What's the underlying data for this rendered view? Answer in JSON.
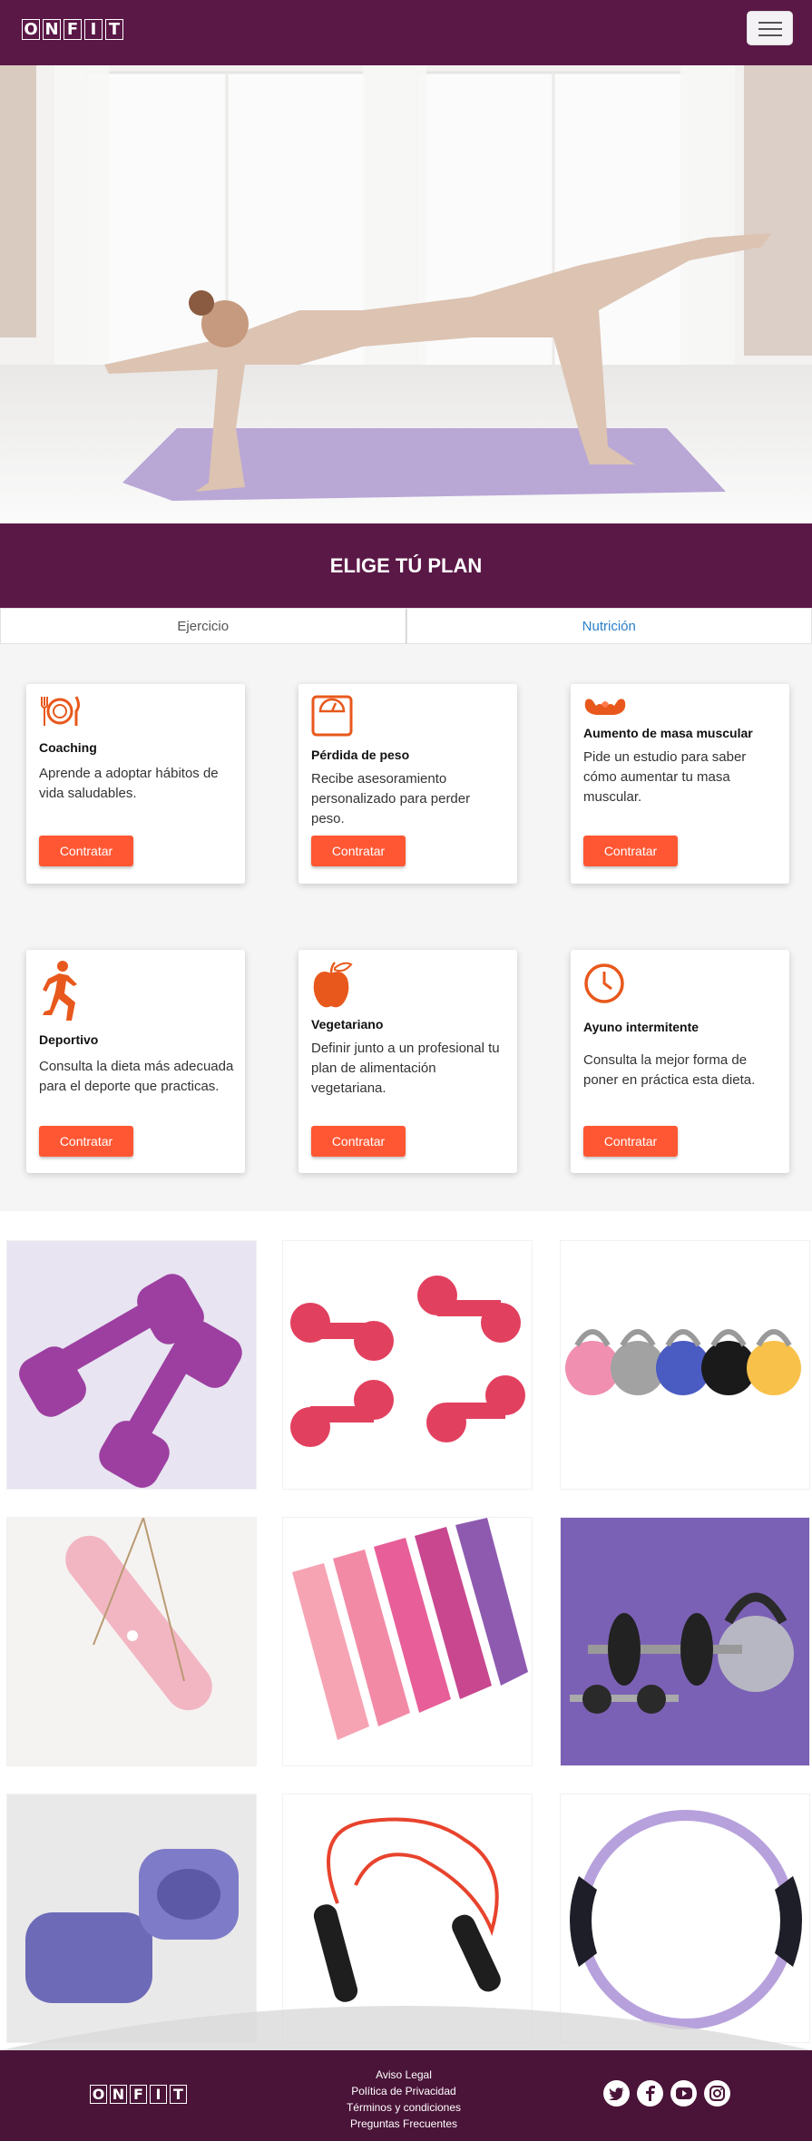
{
  "brand": {
    "letters": [
      "O",
      "N",
      "F",
      "I",
      "T"
    ]
  },
  "nav": {
    "toggler_label": "menu"
  },
  "plans": {
    "title": "ELIGE TÚ PLAN",
    "tabs": [
      {
        "label": "Ejercicio",
        "active": false
      },
      {
        "label": "Nutrición",
        "active": true
      }
    ],
    "cards": [
      {
        "icon": "plate-cutlery-icon",
        "title": "Coaching",
        "text": "Aprende a adoptar hábitos de vida saludables.",
        "button": "Contratar"
      },
      {
        "icon": "scale-icon",
        "title": "Pérdida de peso",
        "text": "Recibe asesoramiento personalizado para perder peso.",
        "button": "Contratar"
      },
      {
        "icon": "muscle-arms-icon",
        "title": "Aumento de masa muscular",
        "text": "Pide un estudio para saber cómo aumentar tu masa muscular.",
        "button": "Contratar"
      },
      {
        "icon": "runner-icon",
        "title": "Deportivo",
        "text": "Consulta la dieta más adecuada para el deporte que practicas.",
        "button": "Contratar"
      },
      {
        "icon": "apple-icon",
        "title": "Vegetariano",
        "text": "Definir junto a un profesional tu plan de alimentación vegetariana.",
        "button": "Contratar"
      },
      {
        "icon": "clock-icon",
        "title": "Ayuno intermitente",
        "text": "Consulta la mejor forma de poner en práctica esta dieta.",
        "button": "Contratar"
      }
    ]
  },
  "footer": {
    "links": [
      "Aviso Legal",
      "Política de Privacidad",
      "Términos y condiciones",
      "Preguntas Frecuentes"
    ],
    "social": [
      "twitter-icon",
      "facebook-icon",
      "youtube-icon",
      "instagram-icon"
    ]
  },
  "colors": {
    "brand": "#5a1846",
    "accent": "#ff5733",
    "icon": "#e8581c",
    "link": "#2a7fc9"
  }
}
